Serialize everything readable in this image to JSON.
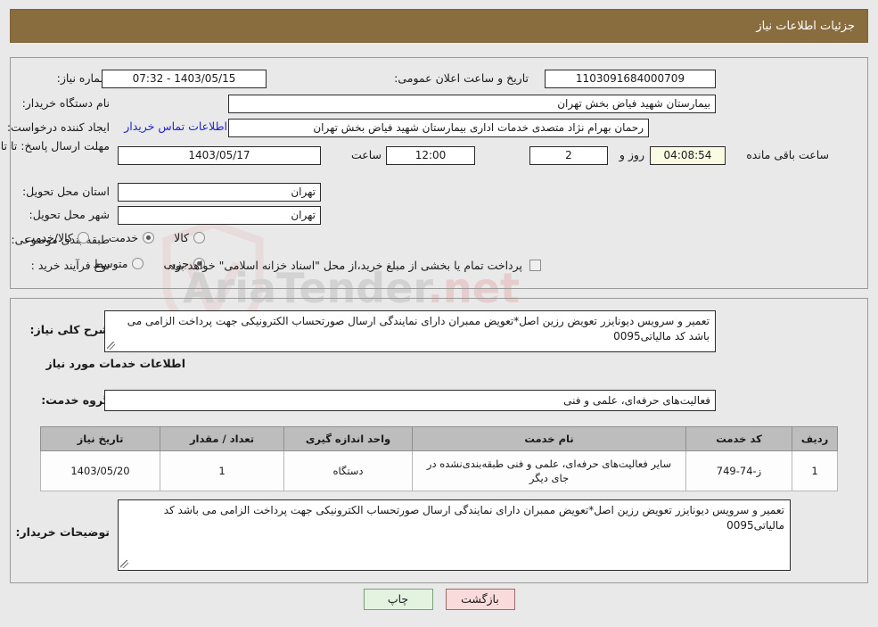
{
  "header": {
    "title": "جزئیات اطلاعات نیاز",
    "bar_color": "#8a6d3e"
  },
  "watermark": {
    "text_left": "AriaTender",
    "text_right": ".net"
  },
  "need_info": {
    "need_number_label": "شماره نیاز:",
    "need_number_value": "1103091684000709",
    "announce_label": "تاریخ و ساعت اعلان عمومی:",
    "announce_value": "1403/05/15 - 07:32",
    "buyer_org_label": "نام دستگاه خریدار:",
    "buyer_org_value": "بیمارستان شهید فیاض بخش تهران",
    "creator_label": "ایجاد کننده درخواست:",
    "creator_value": "رحمان بهرام نژاد متصدی خدمات اداری بیمارستان شهید فیاض بخش تهران",
    "contact_link": "اطلاعات تماس خریدار",
    "deadline_label": "مهلت ارسال پاسخ: تا تاریخ:",
    "deadline_date": "1403/05/17",
    "deadline_time_label": "ساعت",
    "deadline_time": "12:00",
    "days_remaining": "2",
    "days_label": "روز و",
    "countdown": "04:08:54",
    "countdown_suffix": "ساعت باقی مانده",
    "province_label": "استان محل تحویل:",
    "province_value": "تهران",
    "city_label": "شهر محل تحویل:",
    "city_value": "تهران",
    "category_label": "طبقه بندی موضوعی:",
    "category_options": [
      {
        "label": "کالا",
        "selected": false
      },
      {
        "label": "خدمت",
        "selected": true
      },
      {
        "label": "کالا/خدمت",
        "selected": false
      }
    ],
    "process_label": "نوع فرآیند خرید :",
    "process_options": [
      {
        "label": "جزیی",
        "selected": true
      },
      {
        "label": "متوسط",
        "selected": false
      }
    ],
    "treasury_checkbox_checked": false,
    "treasury_text": "پرداخت تمام یا بخشی از مبلغ خرید،از محل \"اسناد خزانه اسلامی\" خواهد بود."
  },
  "need_description": {
    "label": "شرح کلی نیاز:",
    "value": "تعمیر و سرویس دیونایزر تعویض رزین اصل*تعویض ممبران دارای نمایندگی ارسال صورتحساب الکترونیکی جهت پرداخت الزامی می باشد کد مالیاتی0095"
  },
  "services_section": {
    "heading": "اطلاعات خدمات مورد نیاز",
    "group_label": "گروه خدمت:",
    "group_value": "فعالیت‌های حرفه‌ای، علمی و فنی"
  },
  "items_table": {
    "columns": [
      "ردیف",
      "کد خدمت",
      "نام خدمت",
      "واحد اندازه گیری",
      "تعداد / مقدار",
      "تاریخ نیاز"
    ],
    "rows": [
      {
        "row_no": "1",
        "service_code": "ز-74-749",
        "service_name": "سایر فعالیت‌های حرفه‌ای، علمی و فنی طبقه‌بندی‌نشده در جای دیگر",
        "unit": "دستگاه",
        "quantity": "1",
        "need_date": "1403/05/20"
      }
    ]
  },
  "buyer_notes": {
    "label": "توضیحات خریدار:",
    "value": "تعمیر و سرویس دیونایزر تعویض رزین اصل*تعویض ممبران دارای نمایندگی ارسال صورتحساب الکترونیکی جهت پرداخت الزامی می باشد کد مالیاتی0095"
  },
  "footer": {
    "back_label": "بازگشت",
    "print_label": "چاپ"
  }
}
